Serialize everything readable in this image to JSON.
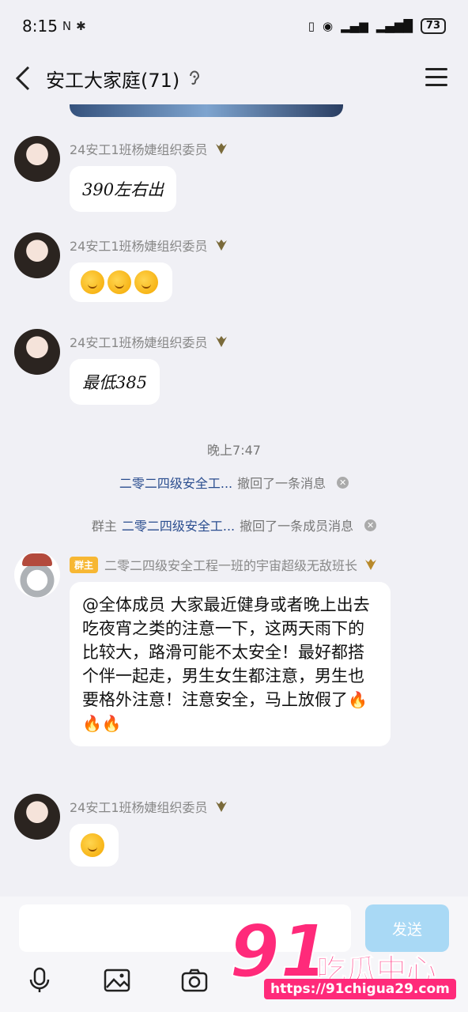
{
  "status": {
    "time": "8:15",
    "battery": "73"
  },
  "header": {
    "title": "安工大家庭(71)"
  },
  "messages": [
    {
      "sender": "24安工1班杨婕组织委员",
      "text": "390左右出"
    },
    {
      "sender": "24安工1班杨婕组织委员"
    },
    {
      "sender": "24安工1班杨婕组织委员",
      "text": "最低385"
    },
    {
      "owner_tag": "群主",
      "sender": "二零二四级安全工程一班的宇宙超级无敌班长",
      "text": "@全体成员 大家最近健身或者晚上出去吃夜宵之类的注意一下，这两天雨下的比较大，路滑可能不太安全！最好都搭个伴一起走，男生女生都注意，男生也要格外注意！注意安全，马上放假了"
    },
    {
      "sender": "24安工1班杨婕组织委员"
    }
  ],
  "system": {
    "time": "晚上7:47",
    "recall1_name": "二零二四级安全工...",
    "recall1_text": "撤回了一条消息",
    "recall2_prefix": "群主",
    "recall2_name": "二零二四级安全工...",
    "recall2_text": "撤回了一条成员消息"
  },
  "input": {
    "placeholder": "",
    "send_label": "发送"
  },
  "watermark": {
    "big": "91",
    "cn": "吃瓜中心",
    "url": "https://91chigua29.com"
  },
  "icons": [
    "back-icon",
    "ear-icon",
    "menu-icon",
    "badge-icon",
    "close-icon",
    "mic-icon",
    "image-icon",
    "camera-icon"
  ]
}
